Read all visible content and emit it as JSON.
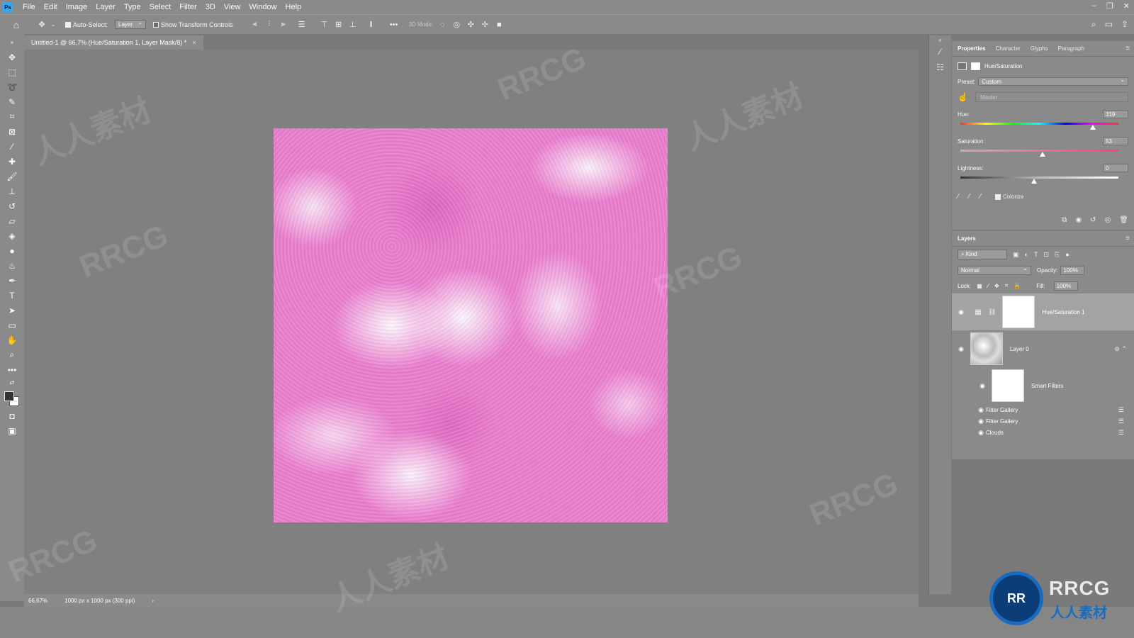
{
  "app": {
    "logo": "Ps"
  },
  "menu": [
    "File",
    "Edit",
    "Image",
    "Layer",
    "Type",
    "Select",
    "Filter",
    "3D",
    "View",
    "Window",
    "Help"
  ],
  "options": {
    "auto_select": "Auto-Select:",
    "layer_dd": "Layer",
    "show_transform": "Show Transform Controls",
    "mode_3d": "3D Mode:"
  },
  "document": {
    "tab_title": "Untitled-1 @ 66,7% (Hue/Saturation 1, Layer Mask/8) *"
  },
  "status": {
    "zoom": "66,67%",
    "dims": "1000 px x 1000 px (300 ppi)",
    "arrow": "›"
  },
  "properties": {
    "tabs": [
      "Properties",
      "Character",
      "Glyphs",
      "Paragraph"
    ],
    "title": "Hue/Saturation",
    "preset_label": "Preset:",
    "preset_value": "Custom",
    "channel": "Master",
    "hue_label": "Hue:",
    "hue_value": "319",
    "hue_pos": 0.905,
    "sat_label": "Saturation:",
    "sat_value": "53",
    "sat_pos": 0.56,
    "light_label": "Lightness:",
    "light_value": "0",
    "light_pos": 0.5,
    "colorize": "Colorize"
  },
  "layers": {
    "title": "Layers",
    "kind": "Kind",
    "blend": "Normal",
    "opacity_label": "Opacity:",
    "opacity": "100%",
    "lock_label": "Lock:",
    "fill_label": "Fill:",
    "fill": "100%",
    "items": [
      {
        "name": "Hue/Saturation 1"
      },
      {
        "name": "Layer 0"
      },
      {
        "name": "Smart Filters"
      }
    ],
    "filters": [
      "Filter Gallery",
      "Filter Gallery",
      "Clouds"
    ]
  },
  "watermark": {
    "logo": "RRCG",
    "sub": "人人素材",
    "text1": "人人素材",
    "text2": "RRCG"
  }
}
